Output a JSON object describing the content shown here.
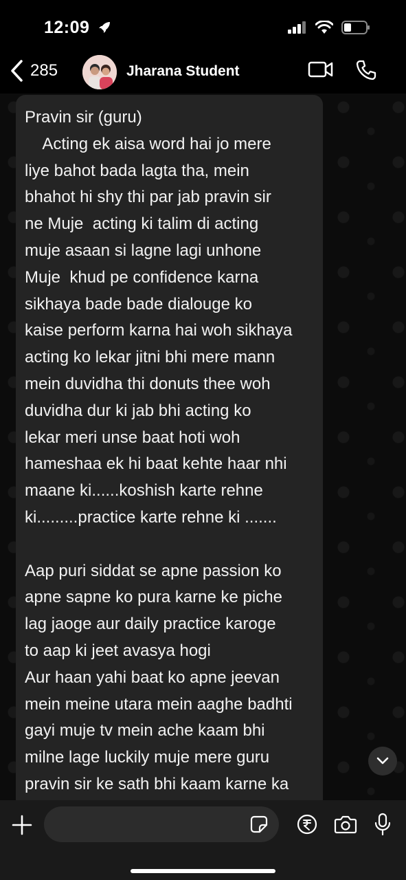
{
  "status_bar": {
    "time": "12:09"
  },
  "header": {
    "back_count": "285",
    "contact_name": "Jharana Student"
  },
  "message": {
    "lines": [
      "Pravin sir (guru)",
      "    Acting ek aisa word hai jo mere",
      "liye bahot bada lagta tha, mein",
      "bhahot hi shy thi par jab pravin sir",
      "ne Muje  acting ki talim di acting",
      "muje asaan si lagne lagi unhone",
      "Muje  khud pe confidence karna",
      "sikhaya bade bade dialouge ko",
      "kaise perform karna hai woh sikhaya",
      "acting ko lekar jitni bhi mere mann",
      "mein duvidha thi donuts thee woh",
      "duvidha dur ki jab bhi acting ko",
      "lekar meri unse baat hoti woh",
      "hameshaa ek hi baat kehte haar nhi",
      "maane ki......koshish karte rehne",
      "ki.........practice karte rehne ki .......",
      "",
      "Aap puri siddat se apne passion ko",
      "apne sapne ko pura karne ke piche",
      "lag jaoge aur daily practice karoge",
      "to aap ki jeet avasya hogi",
      "Aur haan yahi baat ko apne jeevan",
      "mein meine utara mein aaghe badhti",
      "gayi muje tv mein ache kaam bhi",
      "milne lage luckily muje mere guru",
      "pravin sir ke sath bhi kaam karne ka"
    ]
  },
  "icons": {
    "back": "chevron-left-icon",
    "video": "video-camera-icon",
    "call": "phone-icon",
    "scroll": "chevron-down-icon",
    "plus": "plus-icon",
    "sticker": "sticker-icon",
    "rupee": "rupee-payment-icon",
    "camera": "camera-icon",
    "mic": "microphone-icon"
  }
}
